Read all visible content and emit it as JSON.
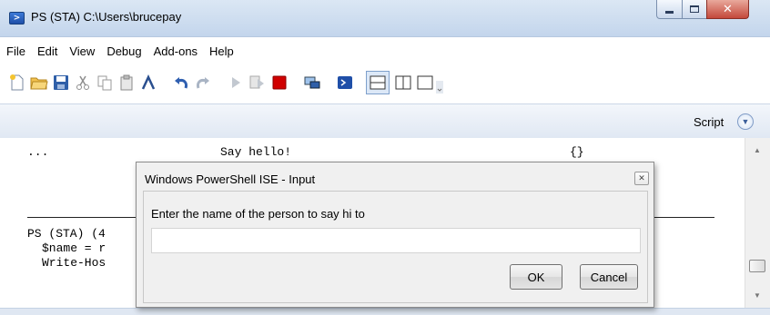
{
  "window": {
    "title": "PS (STA)  C:\\Users\\brucepay",
    "icon": "powershell-icon",
    "buttons": [
      "minimize-icon",
      "maximize-icon",
      "close-icon"
    ]
  },
  "menu": [
    "File",
    "Edit",
    "View",
    "Debug",
    "Add-ons",
    "Help"
  ],
  "toolbar": [
    "new-icon",
    "open-icon",
    "save-icon",
    "cut-icon",
    "copy-icon",
    "paste-icon",
    "clear-icon",
    "undo-icon",
    "redo-icon",
    "run-icon",
    "run-selection-icon",
    "stop-icon",
    "remote-icon",
    "powershell-icon",
    "layout-top-icon",
    "layout-right-icon",
    "layout-max-icon"
  ],
  "script_pane": {
    "label": "Script",
    "toggle_icon": "chevron-down-icon"
  },
  "output": {
    "row1": {
      "col1": "...",
      "col2": "Say hello!",
      "col3": "{}"
    },
    "prompt": "PS (STA) (4",
    "line2": "$name = r",
    "line3": "Write-Hos"
  },
  "dialog": {
    "title": "Windows PowerShell ISE - Input",
    "close_icon": "close-icon",
    "prompt": "Enter the name of the person to say hi to",
    "input_value": "",
    "ok_label": "OK",
    "cancel_label": "Cancel"
  },
  "colors": {
    "titlebar": "#c3d5ec",
    "stop": "#d00000",
    "accent": "#1f4fa8"
  }
}
